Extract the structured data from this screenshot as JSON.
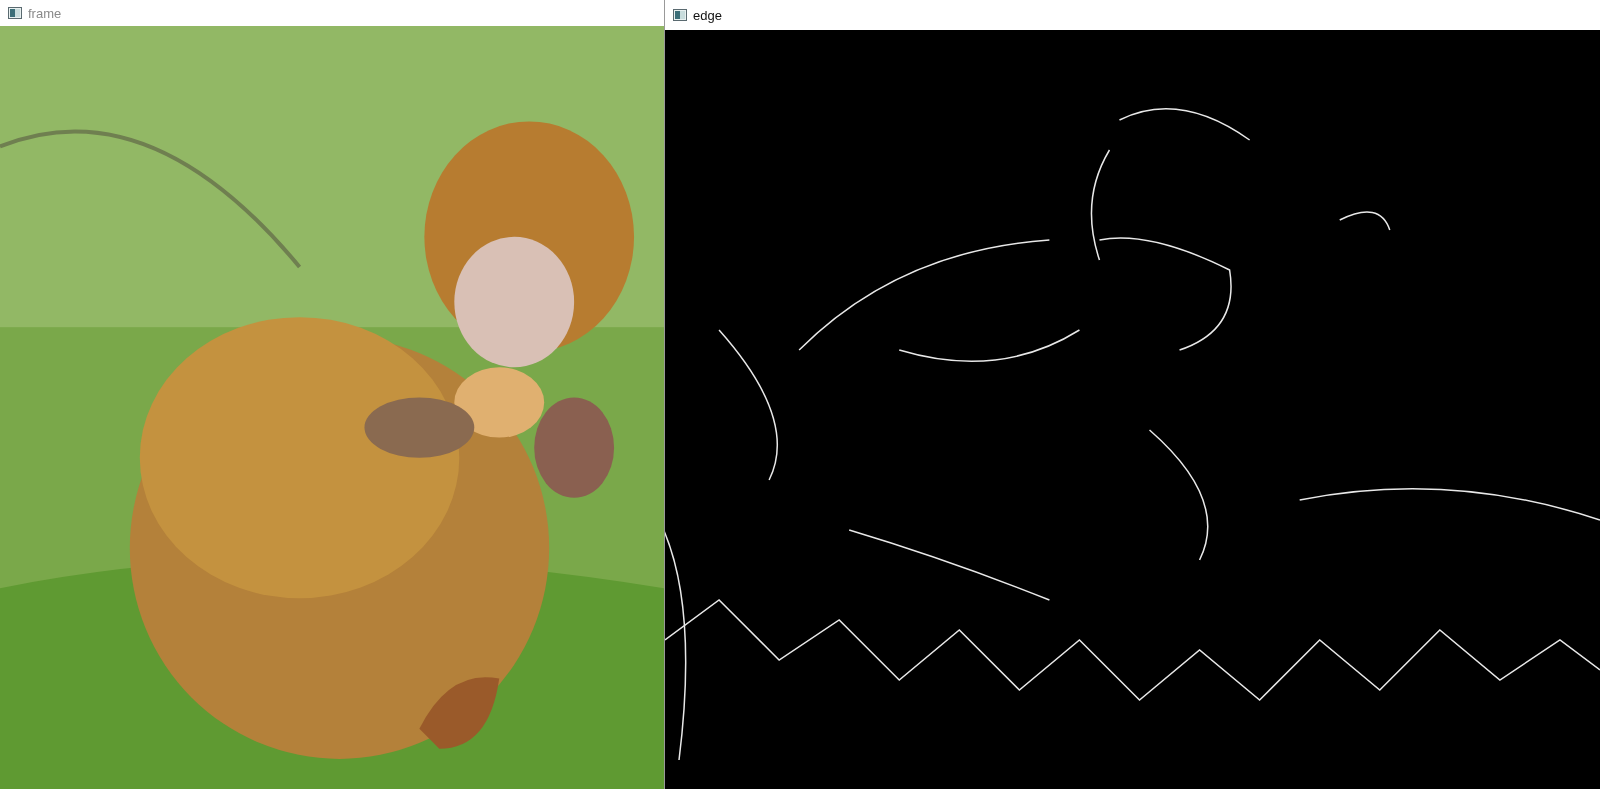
{
  "windows": [
    {
      "title": "frame",
      "active": false
    },
    {
      "title": "edge",
      "active": true,
      "picture": {
        "kind": "edges"
      }
    }
  ]
}
